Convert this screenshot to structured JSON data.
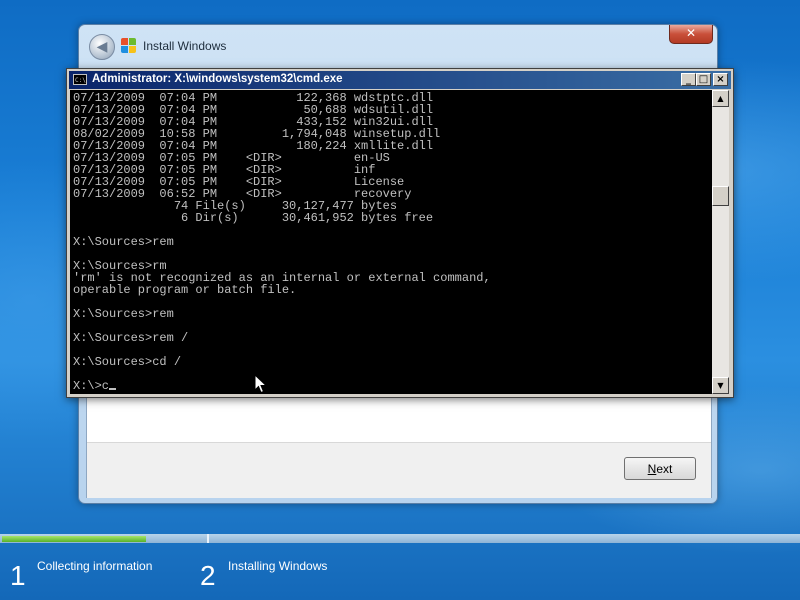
{
  "install_window": {
    "title": "Install Windows",
    "close_symbol": "✕",
    "back_symbol": "◀",
    "next_label_underlined": "N",
    "next_label_rest": "ext"
  },
  "cmd_window": {
    "title": "Administrator: X:\\windows\\system32\\cmd.exe",
    "icon_text": "C:\\",
    "minimize_symbol": "_",
    "maximize_symbol": "□",
    "close_symbol": "×",
    "output": "07/13/2009  07:04 PM           122,368 wdstptc.dll\n07/13/2009  07:04 PM            50,688 wdsutil.dll\n07/13/2009  07:04 PM           433,152 win32ui.dll\n08/02/2009  10:58 PM         1,794,048 winsetup.dll\n07/13/2009  07:04 PM           180,224 xmllite.dll\n07/13/2009  07:05 PM    <DIR>          en-US\n07/13/2009  07:05 PM    <DIR>          inf\n07/13/2009  07:05 PM    <DIR>          License\n07/13/2009  06:52 PM    <DIR>          recovery\n              74 File(s)     30,127,477 bytes\n               6 Dir(s)      30,461,952 bytes free\n\nX:\\Sources>rem\n\nX:\\Sources>rm\n'rm' is not recognized as an internal or external command,\noperable program or batch file.\n\nX:\\Sources>rem\n\nX:\\Sources>rem /\n\nX:\\Sources>cd /\n\n",
    "current_input_line": "X:\\>c"
  },
  "setup_progress": {
    "progress_fraction": 0.18,
    "steps": [
      {
        "number": "1",
        "label": "Collecting information"
      },
      {
        "number": "2",
        "label": "Installing Windows"
      }
    ]
  }
}
